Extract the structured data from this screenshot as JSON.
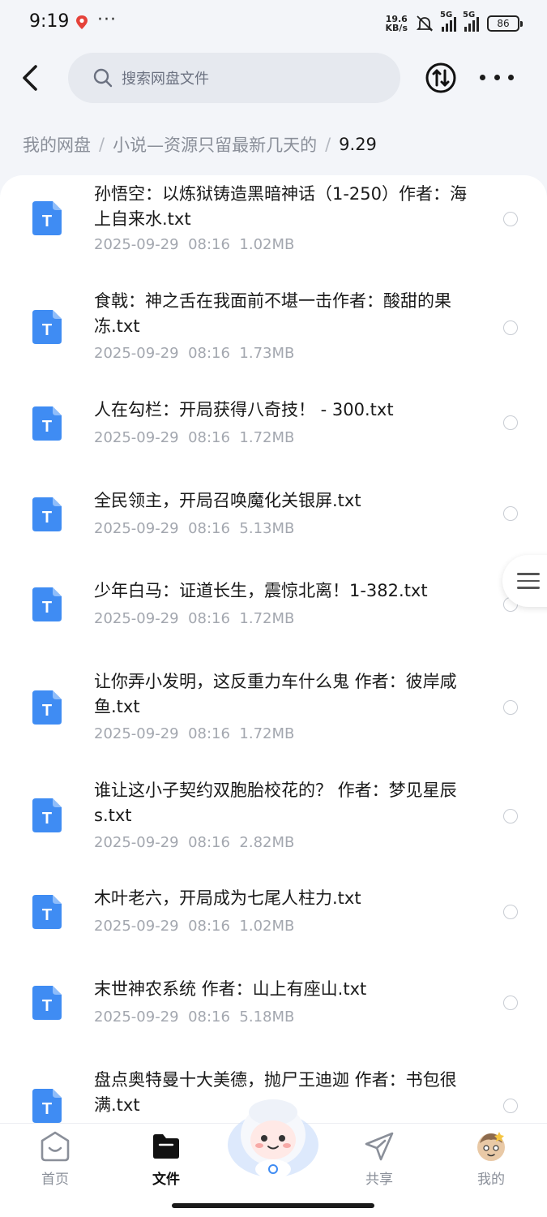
{
  "status_bar": {
    "time": "9:19",
    "dots": "···",
    "net_speed_value": "19.6",
    "net_speed_unit": "KB/s",
    "sim1": "5G",
    "sim2": "5G",
    "battery": "86"
  },
  "search": {
    "placeholder": "搜索网盘文件"
  },
  "breadcrumb": {
    "items": [
      "我的网盘",
      "小说—资源只留最新几天的",
      "9.29"
    ],
    "separator": "/"
  },
  "files": [
    {
      "name": "孙悟空：以炼狱铸造黑暗神话（1-250）作者：海上自来水.txt",
      "date": "2025-09-29",
      "time": "08:16",
      "size": "1.02MB"
    },
    {
      "name": "食戟：神之舌在我面前不堪一击作者：酸甜的果冻.txt",
      "date": "2025-09-29",
      "time": "08:16",
      "size": "1.73MB"
    },
    {
      "name": "人在勾栏：开局获得八奇技！ - 300.txt",
      "date": "2025-09-29",
      "time": "08:16",
      "size": "1.72MB"
    },
    {
      "name": "全民领主，开局召唤魔化关银屏.txt",
      "date": "2025-09-29",
      "time": "08:16",
      "size": "5.13MB"
    },
    {
      "name": "少年白马：证道长生，震惊北离！1-382.txt",
      "date": "2025-09-29",
      "time": "08:16",
      "size": "1.72MB"
    },
    {
      "name": "让你弄小发明，这反重力车什么鬼 作者：彼岸咸鱼.txt",
      "date": "2025-09-29",
      "time": "08:16",
      "size": "1.72MB"
    },
    {
      "name": "谁让这小子契约双胞胎校花的？ 作者：梦见星辰s.txt",
      "date": "2025-09-29",
      "time": "08:16",
      "size": "2.82MB"
    },
    {
      "name": "木叶老六，开局成为七尾人柱力.txt",
      "date": "2025-09-29",
      "time": "08:16",
      "size": "1.02MB"
    },
    {
      "name": "末世神农系统 作者：山上有座山.txt",
      "date": "2025-09-29",
      "time": "08:16",
      "size": "5.18MB"
    },
    {
      "name": "盘点奥特曼十大美德，抛尸王迪迦 作者：书包很满.txt",
      "date": "",
      "time": "",
      "size": ""
    }
  ],
  "file_icon_letter": "T",
  "bottom_nav": {
    "items": [
      {
        "label": "首页",
        "icon": "home-icon"
      },
      {
        "label": "文件",
        "icon": "folder-icon"
      },
      {
        "label": "共享",
        "icon": "share-icon"
      },
      {
        "label": "我的",
        "icon": "profile-avatar-icon"
      }
    ],
    "active": "文件"
  },
  "colors": {
    "background": "#f3f5f9",
    "file_icon": "#3f8cf3",
    "meta_text": "#a3a7af",
    "breadcrumb_muted": "#8a8f99"
  }
}
